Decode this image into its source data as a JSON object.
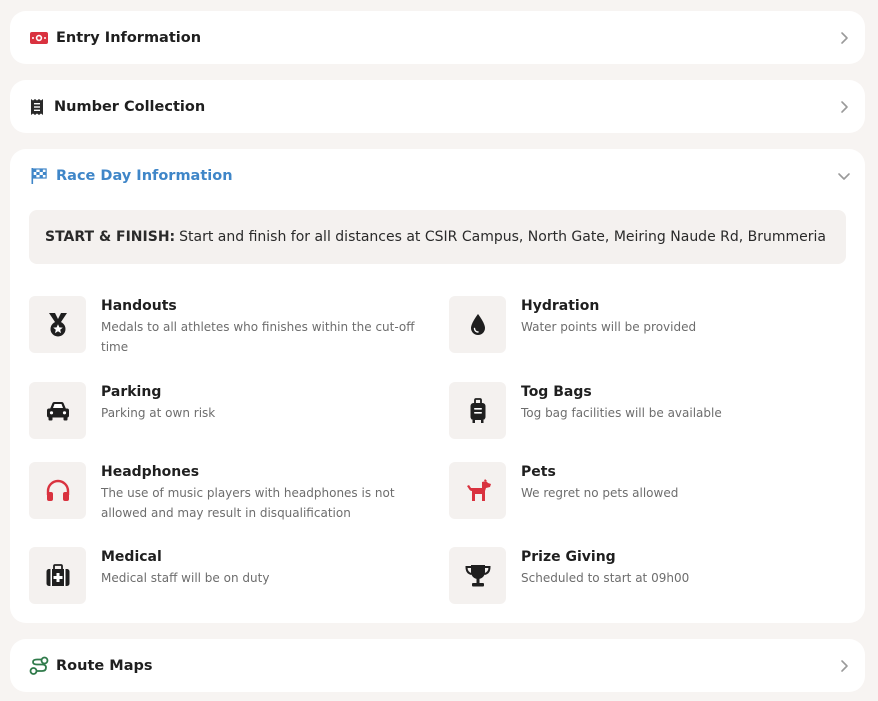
{
  "accordion": {
    "entry": {
      "title": "Entry Information",
      "icon": "ticket-icon",
      "expanded": false
    },
    "number": {
      "title": "Number Collection",
      "icon": "receipt-icon",
      "expanded": false
    },
    "race_day": {
      "title": "Race Day Information",
      "icon": "checkered-flag-icon",
      "expanded": true,
      "banner": {
        "label": "START & FINISH:",
        "text": "Start and finish for all distances at CSIR Campus, North Gate, Meiring Naude Rd, Brummeria"
      },
      "items": [
        {
          "title": "Handouts",
          "desc": "Medals to all athletes who finishes within the cut-off time",
          "icon": "medal-icon"
        },
        {
          "title": "Hydration",
          "desc": "Water points will be provided",
          "icon": "water-drop-icon"
        },
        {
          "title": "Parking",
          "desc": "Parking at own risk",
          "icon": "car-icon"
        },
        {
          "title": "Tog Bags",
          "desc": "Tog bag facilities will be available",
          "icon": "luggage-icon"
        },
        {
          "title": "Headphones",
          "desc": "The use of music players with headphones is not allowed and may result in disqualification",
          "icon": "headphones-icon"
        },
        {
          "title": "Pets",
          "desc": "We regret no pets allowed",
          "icon": "dog-icon"
        },
        {
          "title": "Medical",
          "desc": "Medical staff will be on duty",
          "icon": "medical-kit-icon"
        },
        {
          "title": "Prize Giving",
          "desc": "Scheduled to start at 09h00",
          "icon": "trophy-icon"
        }
      ]
    },
    "route": {
      "title": "Route Maps",
      "icon": "route-icon",
      "expanded": false
    }
  },
  "colors": {
    "page_bg": "#f7f4f2",
    "card_bg": "#ffffff",
    "accent_blue": "#3f86c8",
    "accent_red": "#d9323f",
    "accent_green": "#2f7a4a"
  }
}
